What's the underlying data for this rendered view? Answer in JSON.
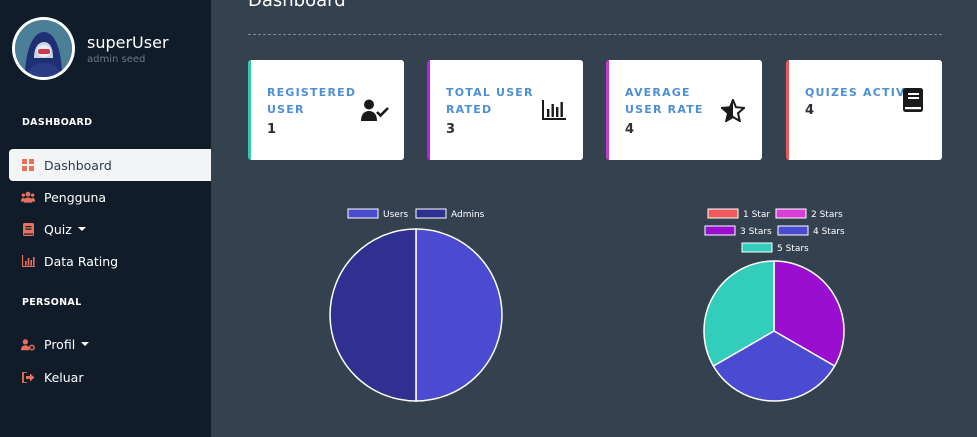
{
  "sidebar": {
    "user_name": "superUser",
    "user_role": "admin seed",
    "section_dashboard": "DASHBOARD",
    "section_personal": "PERSONAL",
    "items": [
      {
        "label": "Dashboard",
        "icon": "grid-icon",
        "active": true
      },
      {
        "label": "Pengguna",
        "icon": "users-icon"
      },
      {
        "label": "Quiz",
        "icon": "book-icon",
        "dropdown": true
      },
      {
        "label": "Data Rating",
        "icon": "bar-chart-icon"
      }
    ],
    "personal_items": [
      {
        "label": "Profil",
        "icon": "user-cog-icon",
        "dropdown": true
      },
      {
        "label": "Keluar",
        "icon": "sign-out-icon"
      }
    ]
  },
  "main": {
    "title": "Dashboard"
  },
  "cards": [
    {
      "title": "REGISTERED USER",
      "value": "1",
      "icon": "user-check-icon",
      "accent": "#36c7b1"
    },
    {
      "title": "TOTAL USER RATED",
      "value": "3",
      "icon": "poll-icon",
      "accent": "#b51fe8"
    },
    {
      "title": "AVERAGE USER RATE",
      "value": "4",
      "icon": "star-half-icon",
      "accent": "#c93ad1"
    },
    {
      "title": "QUIZES ACTIVE",
      "value": "4",
      "icon": "book-icon",
      "accent": "#e6585a"
    }
  ],
  "colors": {
    "sidebar_bg": "#111c2b",
    "main_bg": "#344250",
    "icon_orange": "#e8715a"
  },
  "chart_data": [
    {
      "type": "pie",
      "categories": [
        "Users",
        "Admins"
      ],
      "values": [
        1,
        1
      ],
      "colors": [
        "#4a4bd1",
        "#303090"
      ],
      "legend": "top"
    },
    {
      "type": "pie",
      "categories": [
        "1 Star",
        "2 Stars",
        "3 Stars",
        "4 Stars",
        "5 Stars"
      ],
      "values": [
        0,
        0,
        1,
        1,
        1
      ],
      "colors": [
        "#ef5b5b",
        "#d93fd8",
        "#9a0ecf",
        "#4a4bd1",
        "#33cdbb"
      ],
      "legend": "top"
    }
  ]
}
